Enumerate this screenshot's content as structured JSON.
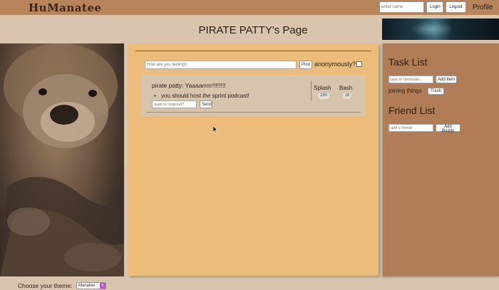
{
  "nav": {
    "logo": "HuManatee",
    "name_placeholder": "enter name",
    "login_label": "Login",
    "logout_label": "Logout",
    "profile_label": "Profile"
  },
  "page": {
    "title": "PIRATE PATTY's Page"
  },
  "compose": {
    "placeholder": "How are you feeling?",
    "post_label": "Post",
    "anon_label": "anonymously?"
  },
  "posts": [
    {
      "text": "pirate patty: Yaaaarrrrr!!!!!!!!",
      "reply": "you should host the sprint podcast!",
      "respond_placeholder": "want to respond?",
      "send_label": "Send",
      "splash_label": "Splash",
      "splash_count": "150",
      "bash_label": "Bash",
      "bash_count": "16"
    }
  ],
  "tasks": {
    "title": "Task List",
    "placeholder": "task to dominate...",
    "add_label": "Add Item",
    "items": [
      {
        "label": "joining things",
        "trash_label": "Trash"
      }
    ]
  },
  "friends": {
    "title": "Friend List",
    "placeholder": "add a friend!",
    "add_label": "Add Buddy"
  },
  "footer": {
    "theme_label": "Choose your theme:",
    "theme_value": "Manatee"
  },
  "colors": {
    "nav": "#b8845c",
    "background": "#d9c4ae",
    "center_panel": "#ecbc7a",
    "right_panel": "#b07d56",
    "post_card": "#d7c4ad"
  }
}
